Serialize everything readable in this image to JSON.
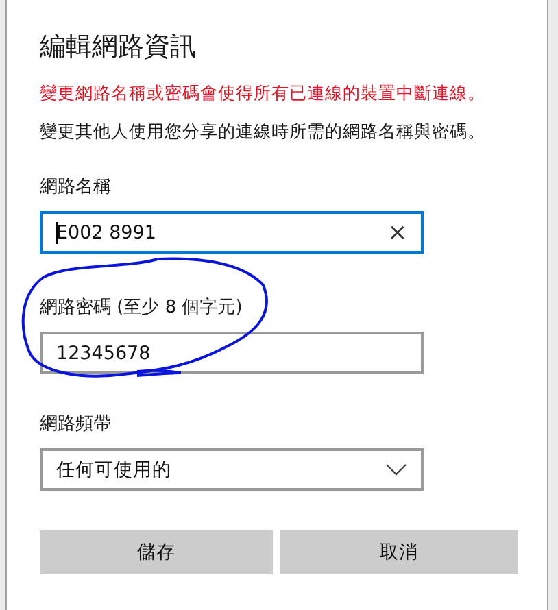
{
  "dialog": {
    "title": "編輯網路資訊",
    "warning": "變更網路名稱或密碼會使得所有已連線的裝置中斷連線。",
    "description": "變更其他人使用您分享的連線時所需的網路名稱與密碼。",
    "fields": [
      {
        "kind": "text",
        "label": "網路名稱",
        "value": "E002 8991",
        "focused": true,
        "clear_button": "×"
      },
      {
        "kind": "text",
        "label": "網路密碼 (至少 8 個字元)",
        "value": "12345678",
        "focused": false
      },
      {
        "kind": "select",
        "label": "網路頻帶",
        "value": "任何可使用的",
        "focused": false
      }
    ],
    "buttons": [
      "儲存",
      "取消"
    ]
  }
}
